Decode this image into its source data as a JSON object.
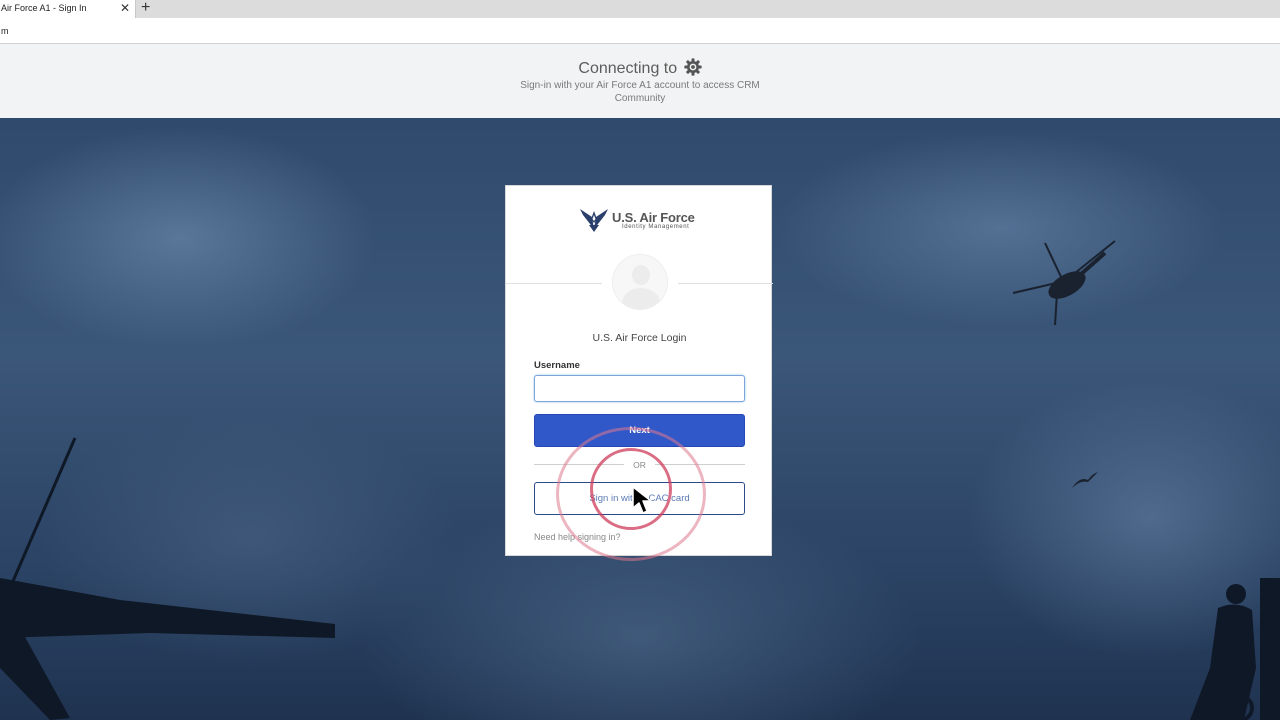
{
  "browser": {
    "tab_title": "Air Force A1 - Sign In",
    "tab_close": "✕",
    "new_tab": "+",
    "address": "m"
  },
  "banner": {
    "title": "Connecting to",
    "subtitle": "Sign-in with your Air Force A1 account to access CRM Community",
    "icon": "gear-icon"
  },
  "card": {
    "logo_title": "U.S. Air Force",
    "logo_subtitle": "Identity Management",
    "login_title": "U.S. Air Force Login",
    "username_label": "Username",
    "username_value": "",
    "next_label": "Next",
    "or_label": "OR",
    "cac_label": "Sign in with a CAC card",
    "help_label": "Need help signing in?"
  },
  "colors": {
    "primary": "#3158c9",
    "cac_border": "#2d4a8a",
    "click_indicator": "#cd3c5a"
  }
}
